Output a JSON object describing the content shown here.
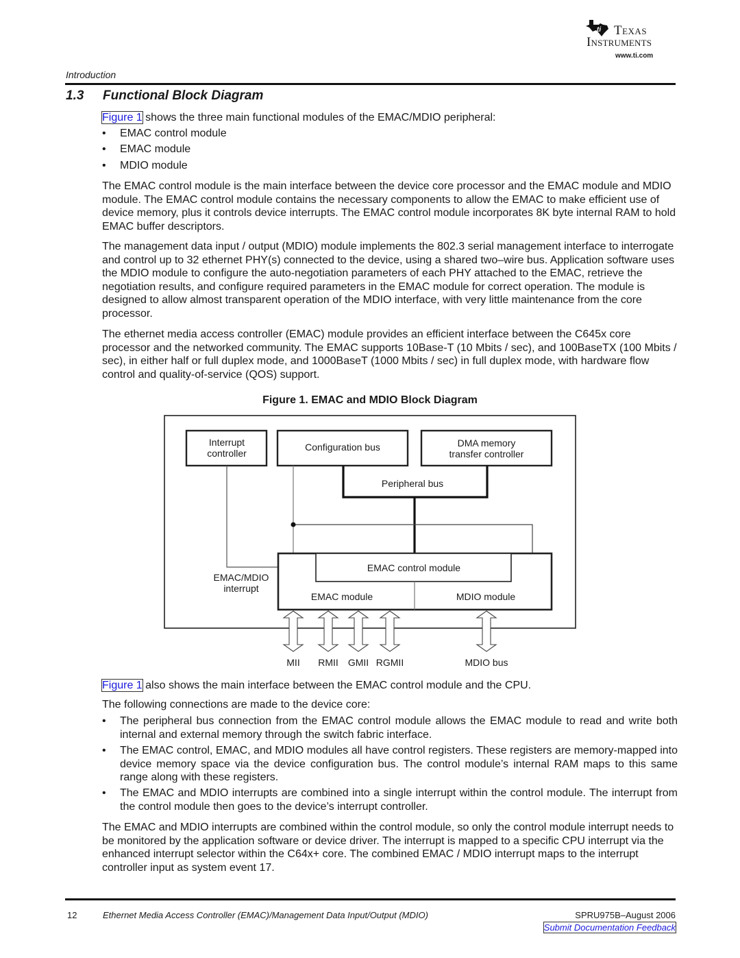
{
  "header": {
    "logo": {
      "line1": "Texas",
      "line2": "Instruments",
      "url": "www.ti.com"
    },
    "section_label": "Introduction"
  },
  "section": {
    "number": "1.3",
    "title": "Functional Block Diagram"
  },
  "intro": {
    "link": "Figure 1",
    "text": " shows the three main functional modules of the EMAC/MDIO peripheral:",
    "bullets": [
      "EMAC control module",
      "EMAC module",
      "MDIO module"
    ]
  },
  "paragraphs": [
    "The EMAC control module is the main interface between the device core processor and the EMAC module and MDIO module. The EMAC control module contains the necessary components to allow the EMAC to make efficient use of device memory, plus it controls device interrupts. The EMAC control module incorporates 8K byte internal RAM to hold EMAC buffer descriptors.",
    "The management data input / output (MDIO) module implements the 802.3 serial management interface to interrogate and control up to 32 ethernet PHY(s) connected to the device, using a shared two–wire bus. Application software uses the MDIO module to configure the auto-negotiation parameters of each PHY attached to the EMAC, retrieve the negotiation results, and configure required parameters in the EMAC module for correct operation. The module is designed to allow almost transparent operation of the MDIO interface, with very little maintenance from the core processor.",
    "The ethernet media access controller (EMAC) module provides an efficient interface between the C645x core processor and the networked community. The EMAC supports 10Base-T (10 Mbits / sec), and 100BaseTX (100 Mbits / sec), in either half or full duplex mode, and 1000BaseT (1000 Mbits / sec) in full duplex mode, with hardware flow control and quality-of-service (QOS) support."
  ],
  "figure": {
    "caption": "Figure 1.  EMAC and MDIO Block Diagram",
    "blocks": {
      "interrupt_controller": [
        "Interrupt",
        "controller"
      ],
      "configuration_bus": "Configuration bus",
      "dma_controller": [
        "DMA memory",
        "transfer controller"
      ],
      "peripheral_bus": "Peripheral bus",
      "emac_control": "EMAC control module",
      "emac_module": "EMAC module",
      "mdio_module": "MDIO module",
      "interrupt_label": [
        "EMAC/MDIO",
        "interrupt"
      ]
    },
    "ports": [
      "MII",
      "RMII",
      "GMII",
      "RGMII",
      "MDIO bus"
    ]
  },
  "after_figure": {
    "link": "Figure 1",
    "text": " also shows the main interface between the EMAC control module and the CPU.",
    "connections_intro": "The following connections are made to the device core:",
    "bullets": [
      "The peripheral bus connection from the EMAC control module allows the EMAC module to read and write both internal and external memory through the switch fabric interface.",
      "The EMAC control, EMAC, and MDIO modules all have control registers. These registers are memory-mapped into device memory space via the device configuration bus. The control module’s internal RAM maps to this same range along with these registers.",
      "The EMAC and MDIO interrupts are combined into a single interrupt within the control module. The interrupt from the control module then goes to the device’s interrupt controller."
    ],
    "closing": "The EMAC and MDIO interrupts are combined within the control module, so only the control module interrupt needs to be monitored by the application software or device driver. The interrupt is mapped to a specific CPU interrupt via the enhanced interrupt selector within the C64x+ core. The combined EMAC / MDIO interrupt maps to the interrupt controller input as system event 17."
  },
  "footer": {
    "page": "12",
    "title": "Ethernet Media Access Controller (EMAC)/Management Data Input/Output (MDIO)",
    "doc_id": "SPRU975B–August 2006",
    "feedback_link": "Submit Documentation Feedback"
  }
}
